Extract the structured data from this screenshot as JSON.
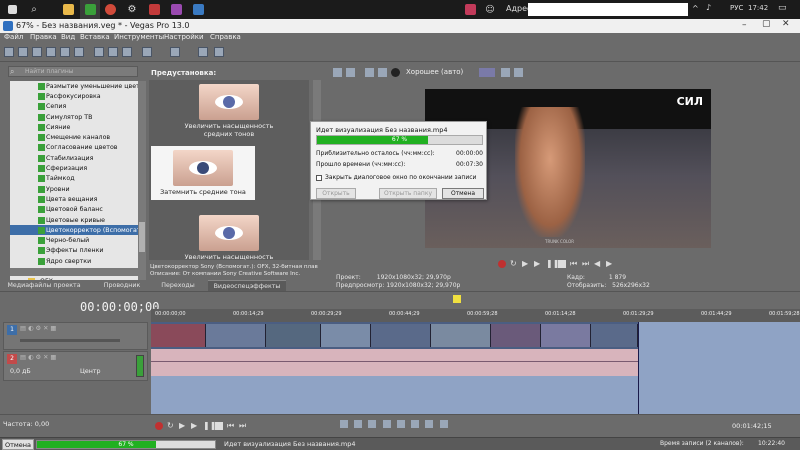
{
  "taskbar": {
    "address_label": "Адрес",
    "lang": "РУС",
    "clock": "17:42"
  },
  "window": {
    "title": "67% - Без названия.veg * - Vegas Pro 13.0"
  },
  "menu": [
    "Файл",
    "Правка",
    "Вид",
    "Вставка",
    "Инструменты",
    "Настройки",
    "Справка"
  ],
  "left_panel": {
    "search_placeholder": "Найти плагины",
    "effects": [
      "Размытие уменьшение цветности",
      "Расфокусировка",
      "Сепия",
      "Симулятор ТВ",
      "Сияние",
      "Смещение каналов",
      "Согласование цветов",
      "Стабилизация",
      "Сферизация",
      "Таймкод",
      "Уровни",
      "Цвета вещания",
      "Цветовой баланс",
      "Цветовые кривые",
      "Цветокорректор (Вспомогат...",
      "Черно-белый",
      "Эффекты пленки",
      "Ядро свертки",
      "Яркость и контраст",
      "OFX"
    ],
    "selected_index": 14
  },
  "presets": {
    "label": "Предустановка:",
    "items": [
      {
        "name": "Увеличить насыщенность средних тонов"
      },
      {
        "name": "Затемнить средние тона"
      },
      {
        "name": "Увеличить насыщенность"
      }
    ],
    "selected_index": 1,
    "desc_line1": "Цветокорректор Sony (Вспомогат.): OFX, 32-битная плав",
    "desc_line2": "Описание: От компании Sony Creative Software Inc."
  },
  "panel_tabs": [
    "Медиафайлы проекта",
    "Проводник",
    "Переходы",
    "Видеоспецэффекты"
  ],
  "preview": {
    "quality": "Хорошее (авто)",
    "watermark": "СИЛ",
    "video_credit": "TRUNK COLOR",
    "project_label": "Проект:",
    "project_value": "1920x1080x32; 29,970p",
    "preview_label": "Предпросмотр:",
    "preview_value": "1920x1080x32; 29,970p",
    "frame_label": "Кадр:",
    "frame_value": "1 879",
    "display_label": "Отобразить:",
    "display_value": "526x296x32"
  },
  "render_dialog": {
    "title": "Идет визуализация Без названия.mp4",
    "progress_percent": 67,
    "progress_text": "67 %",
    "remaining_label": "Приблизительно осталось (чч:мм:сс):",
    "remaining_value": "00:00:00",
    "elapsed_label": "Прошло времени (чч:мм:сс):",
    "elapsed_value": "00:07:30",
    "close_on_finish": "Закрыть диалоговое окно по окончании записи",
    "btn_open": "Открыть",
    "btn_open_folder": "Открыть папку",
    "btn_cancel": "Отмена"
  },
  "timeline": {
    "timecode": "00:00:00;00",
    "ruler_marks": [
      "00:00:00;00",
      "00:00:14;29",
      "00:00:29;29",
      "00:00:44;29",
      "00:00:59;28",
      "00:01:14;28",
      "00:01:29;29",
      "00:01:44;29",
      "00:01:59;28"
    ],
    "audio_db": "0,0 дБ",
    "audio_pan": "Центр",
    "video_track_num": "1",
    "audio_track_num": "2"
  },
  "bottom": {
    "rate": "Частота: 0,00",
    "time": "00:01:42;15"
  },
  "status": {
    "cancel": "Отмена",
    "percent": 67,
    "percent_text": "67 %",
    "text": "Идет визуализация Без названия.mp4",
    "record_time": "Время записи (2 каналов):",
    "record_value": "10:22:40"
  },
  "colors": {
    "progress_green": "#21b021",
    "selection_blue": "#3d6ea8",
    "track_blue": "#8fa3c5",
    "audio_pink": "#d8b4bc"
  }
}
